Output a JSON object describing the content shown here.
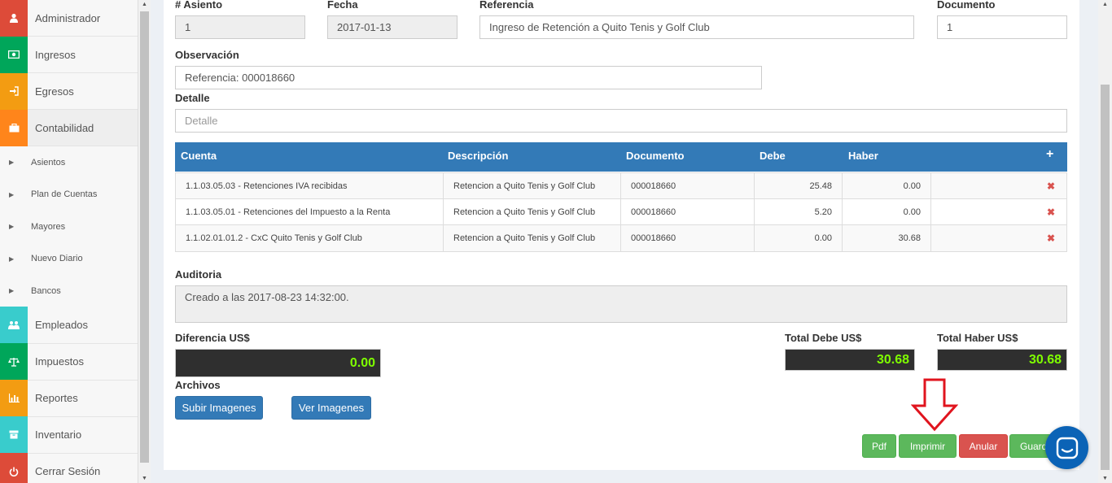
{
  "sidebar": {
    "items": [
      {
        "label": "Administrador",
        "icon": "user-icon",
        "color": "#dd4b39"
      },
      {
        "label": "Ingresos",
        "icon": "money-icon",
        "color": "#00a65a"
      },
      {
        "label": "Egresos",
        "icon": "sign-in-icon",
        "color": "#f39c12"
      },
      {
        "label": "Contabilidad",
        "icon": "briefcase-icon",
        "color": "#ff851b"
      }
    ],
    "subitems": [
      "Asientos",
      "Plan de Cuentas",
      "Mayores",
      "Nuevo Diario",
      "Bancos"
    ],
    "items_after": [
      {
        "label": "Empleados",
        "icon": "users-icon",
        "color": "#39cccc"
      },
      {
        "label": "Impuestos",
        "icon": "balance-scale-icon",
        "color": "#00a65a"
      },
      {
        "label": "Reportes",
        "icon": "bar-chart-icon",
        "color": "#f39c12"
      },
      {
        "label": "Inventario",
        "icon": "box-icon",
        "color": "#39cccc"
      },
      {
        "label": "Cerrar Sesión",
        "icon": "power-icon",
        "color": "#dd4b39"
      }
    ]
  },
  "form": {
    "asiento_label": "# Asiento",
    "asiento_value": "1",
    "fecha_label": "Fecha",
    "fecha_value": "2017-01-13",
    "referencia_label": "Referencia",
    "referencia_value": "Ingreso de Retención a  Quito Tenis y Golf Club",
    "documento_label": "Documento",
    "documento_value": "1",
    "observacion_label": "Observación",
    "observacion_value": "Referencia: 000018660",
    "detalle_label": "Detalle",
    "detalle_placeholder": "Detalle"
  },
  "table": {
    "headers": [
      "Cuenta",
      "Descripción",
      "Documento",
      "Debe",
      "Haber"
    ],
    "add_symbol": "+",
    "delete_symbol": "✖",
    "rows": [
      {
        "cuenta": "1.1.03.05.03 - Retenciones IVA  recibidas",
        "descripcion": "Retencion a  Quito Tenis y Golf Club",
        "documento": "000018660",
        "debe": "25.48",
        "haber": "0.00"
      },
      {
        "cuenta": "1.1.03.05.01 - Retenciones del Impuesto a la Renta",
        "descripcion": "Retencion a  Quito Tenis y Golf Club",
        "documento": "000018660",
        "debe": "5.20",
        "haber": "0.00"
      },
      {
        "cuenta": "1.1.02.01.01.2 - CxC  Quito Tenis y Golf Club",
        "descripcion": "Retencion a  Quito Tenis y Golf Club",
        "documento": "000018660",
        "debe": "0.00",
        "haber": "30.68"
      }
    ]
  },
  "auditoria": {
    "label": "Auditoria",
    "text": "Creado a las 2017-08-23 14:32:00."
  },
  "totals": {
    "diferencia_label": "Diferencia US$",
    "diferencia_value": "0.00",
    "total_debe_label": "Total Debe US$",
    "total_debe_value": "30.68",
    "total_haber_label": "Total Haber US$",
    "total_haber_value": "30.68"
  },
  "archivos": {
    "label": "Archivos",
    "subir": "Subir Imagenes",
    "ver": "Ver Imagenes"
  },
  "actions": {
    "pdf": "Pdf",
    "imprimir": "Imprimir",
    "anular": "Anular",
    "guardar": "Guard"
  },
  "colors": {
    "primary": "#337ab7",
    "success": "#5cb85c",
    "danger": "#d9534f",
    "annotation_arrow": "#e0141e",
    "total_text": "#7fff00",
    "chat": "#0b63b6"
  }
}
